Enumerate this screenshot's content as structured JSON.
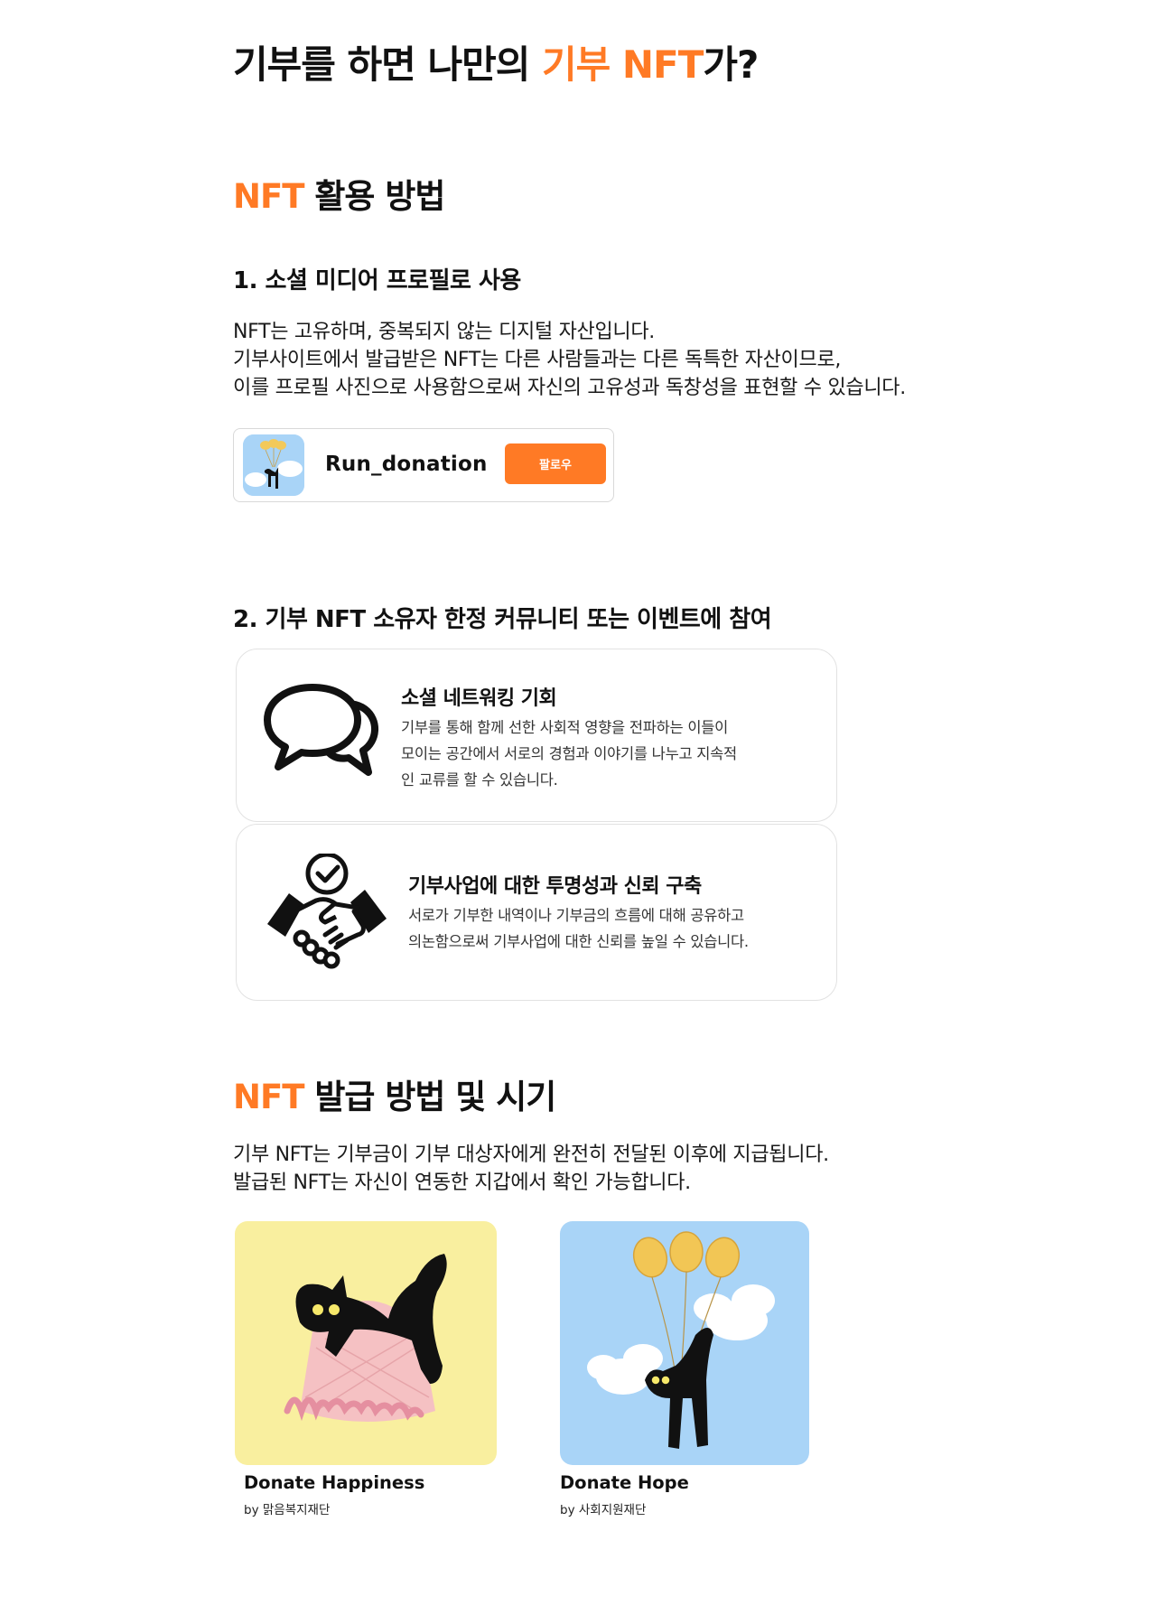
{
  "hero": {
    "title_prefix": "기부를 하면 나만의 ",
    "title_accent": "기부 NFT",
    "title_suffix": "가?"
  },
  "usage": {
    "heading_accent": "NFT",
    "heading_rest": " 활용 방법",
    "profile_section": {
      "title": "1. 소셜 미디어 프로필로 사용",
      "lines": [
        "NFT는 고유하며, 중복되지 않는 디지털 자산입니다.",
        "기부사이트에서 발급받은 NFT는 다른 사람들과는 다른 독특한 자산이므로,",
        "이를 프로필 사진으로 사용함으로써 자신의 고유성과 독창성을 표현할 수 있습니다."
      ],
      "profile_card": {
        "username": "Run_donation",
        "follow_label": "팔로우"
      }
    },
    "community_section": {
      "title": "2. 기부 NFT 소유자 한정 커뮤니티 또는 이벤트에 참여",
      "cards": [
        {
          "icon": "chat-bubbles-icon",
          "title": "소셜 네트워킹 기회",
          "lines": [
            "기부를 통해 함께 선한 사회적 영향을 전파하는 이들이",
            "모이는 공간에서 서로의 경험과 이야기를 나누고 지속적",
            "인 교류를 할 수 있습니다."
          ]
        },
        {
          "icon": "handshake-check-icon",
          "title": "기부사업에 대한 투명성과 신뢰 구축",
          "lines": [
            "서로가 기부한 내역이나 기부금의 흐름에 대해 공유하고",
            "의논함으로써 기부사업에 대한 신뢰를 높일 수 있습니다."
          ]
        }
      ]
    }
  },
  "issuance": {
    "heading_accent": "NFT",
    "heading_rest": " 발급 방법 및 시기",
    "lines": [
      "기부 NFT는 기부금이 기부 대상자에게 완전히 전달된 이후에 지급됩니다.",
      "발급된 NFT는 자신이 연동한 지갑에서 확인 가능합니다."
    ],
    "nfts": [
      {
        "name": "Donate Happiness",
        "by": "by 맑음복지재단",
        "bg_color": "#f9ef9f"
      },
      {
        "name": "Donate Hope",
        "by": "by 사회지원재단",
        "bg_color": "#a9d4f7"
      }
    ]
  },
  "colors": {
    "accent": "#ff7a25"
  }
}
